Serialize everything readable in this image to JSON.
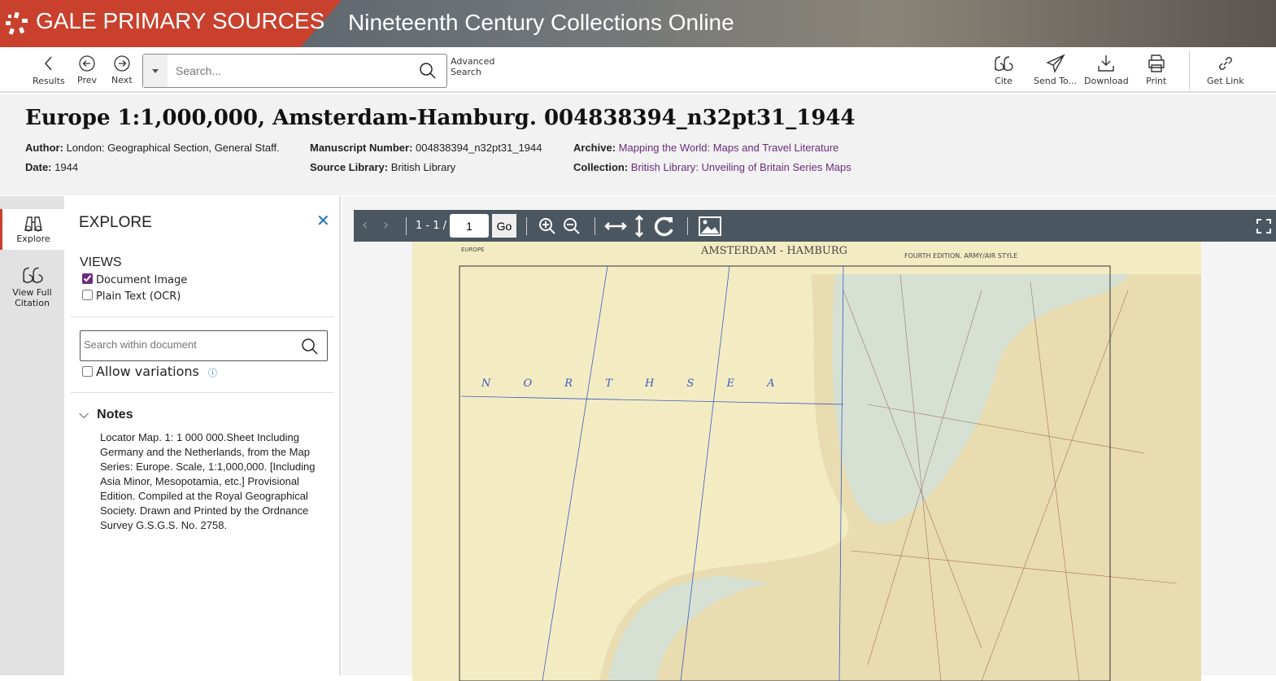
{
  "banner": {
    "brand": "GALE PRIMARY SOURCES",
    "collection": "Nineteenth Century Collections Online"
  },
  "toolbar": {
    "results": "Results",
    "prev": "Prev",
    "next": "Next",
    "search_placeholder": "Search...",
    "advanced_1": "Advanced",
    "advanced_2": "Search",
    "cite": "Cite",
    "send_to": "Send To...",
    "download": "Download",
    "print": "Print",
    "get_link": "Get Link"
  },
  "doc": {
    "title": "Europe 1:1,000,000, Amsterdam-Hamburg. 004838394_n32pt31_1944",
    "author_label": "Author:",
    "author": "London: Geographical Section, General Staff.",
    "date_label": "Date:",
    "date": "1944",
    "manuscript_label": "Manuscript Number:",
    "manuscript": "004838394_n32pt31_1944",
    "source_label": "Source Library:",
    "source": "British Library",
    "archive_label": "Archive:",
    "archive": "Mapping the World: Maps and Travel Literature",
    "collection_label": "Collection:",
    "collection": "British Library: Unveiling of Britain Series Maps"
  },
  "rail": {
    "explore": "Explore",
    "citation_1": "View Full",
    "citation_2": "Citation"
  },
  "explore": {
    "heading": "EXPLORE",
    "views_heading": "VIEWS",
    "document_image": "Document Image",
    "document_image_checked": true,
    "plain_text": "Plain Text (OCR)",
    "plain_text_checked": false,
    "search_placeholder": "Search within document",
    "allow_variations": "Allow variations",
    "notes_heading": "Notes",
    "notes": "Locator Map. 1: 1 000 000.Sheet Including Germany and the Netherlands, from the Map Series: Europe. Scale, 1:1,000,000. [Including Asia Minor, Mesopotamia, etc.] Provisional Edition. Compiled at the Royal Geographical Society. Drawn and Printed by the Ordnance Survey G.S.G.S. No. 2758."
  },
  "viewer": {
    "page_range": "1 - 1 /",
    "page_value": "1",
    "go": "Go",
    "map_title": "AMSTERDAM - HAMBURG",
    "map_edition": "FOURTH EDITION. ARMY/AIR STYLE",
    "map_corner": "EUROPE",
    "sea_label": "N O R T H   S E A"
  },
  "colors": {
    "brand": "#c9402d",
    "link": "#6b2c7e",
    "viewer_toolbar": "#4b5760"
  }
}
